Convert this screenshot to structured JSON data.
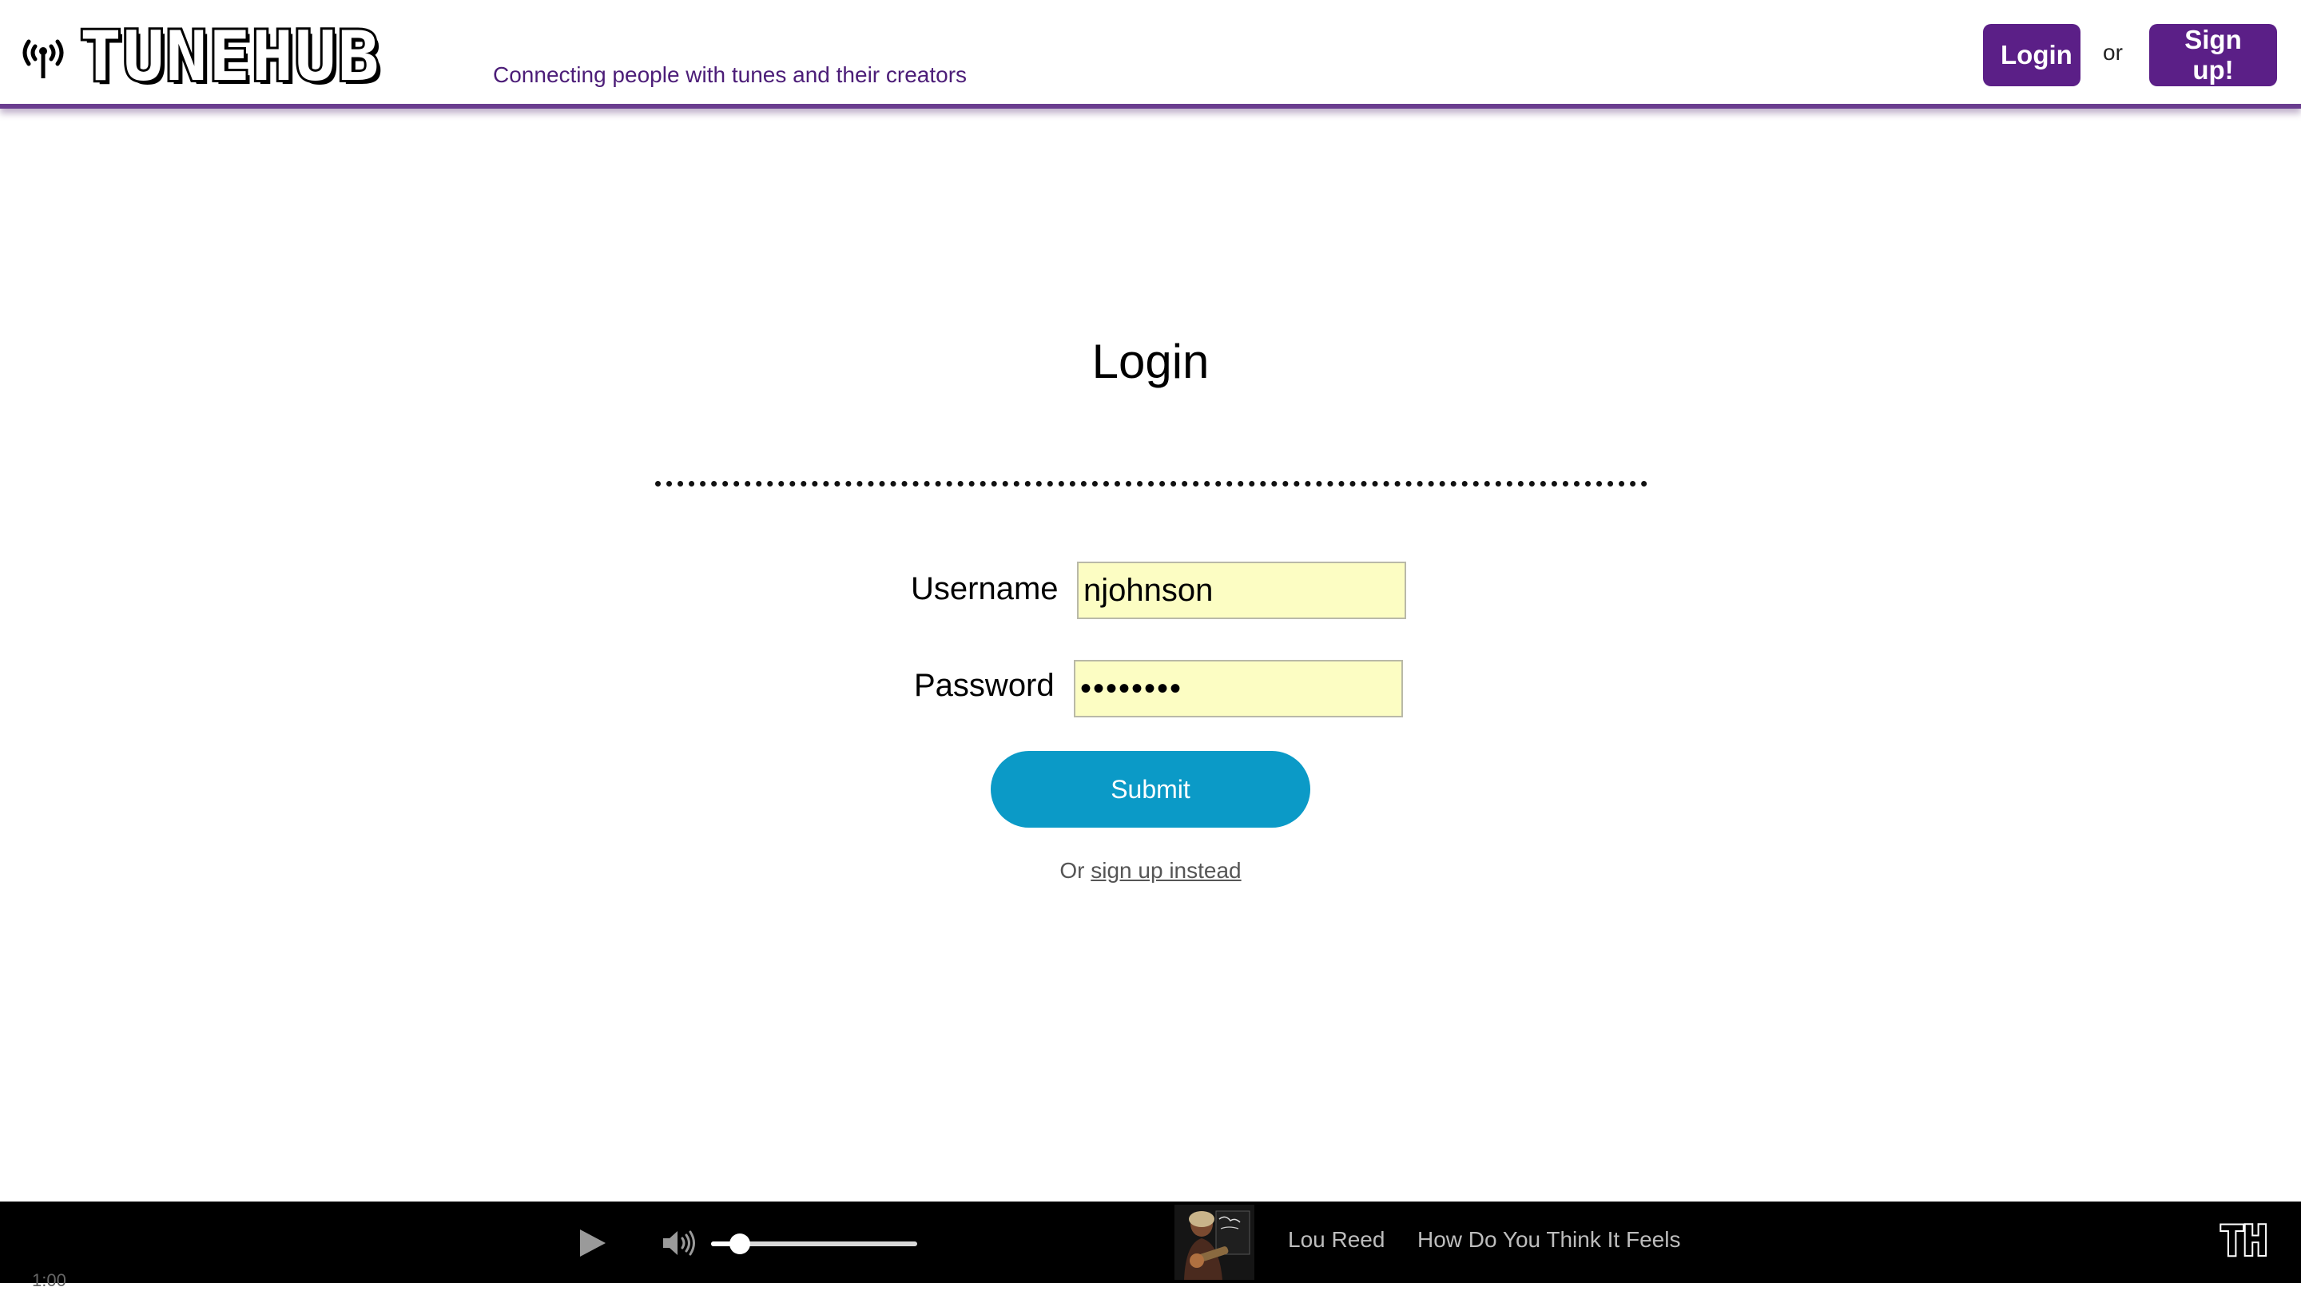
{
  "header": {
    "logo_text": "TUNEHUB",
    "tagline": "Connecting people with tunes and their creators",
    "login_label": "Login",
    "or_text": "or",
    "signup_label": "Sign up!",
    "brand_color": "#5b1f87"
  },
  "form": {
    "title": "Login",
    "username_label": "Username",
    "username_value": "njohnson",
    "password_label": "Password",
    "password_value": "••••••••",
    "submit_label": "Submit",
    "alt_prefix": "Or ",
    "alt_link_label": "sign up instead",
    "input_bg_color": "#fcfdc3",
    "submit_color": "#0b9ac7"
  },
  "player": {
    "elapsed": "1:00",
    "volume_fraction": 0.14,
    "artist": "Lou Reed",
    "track": "How Do You Think It Feels",
    "mini_logo_text": "TH",
    "play_icon": "play-icon",
    "volume_icon": "speaker-icon"
  }
}
